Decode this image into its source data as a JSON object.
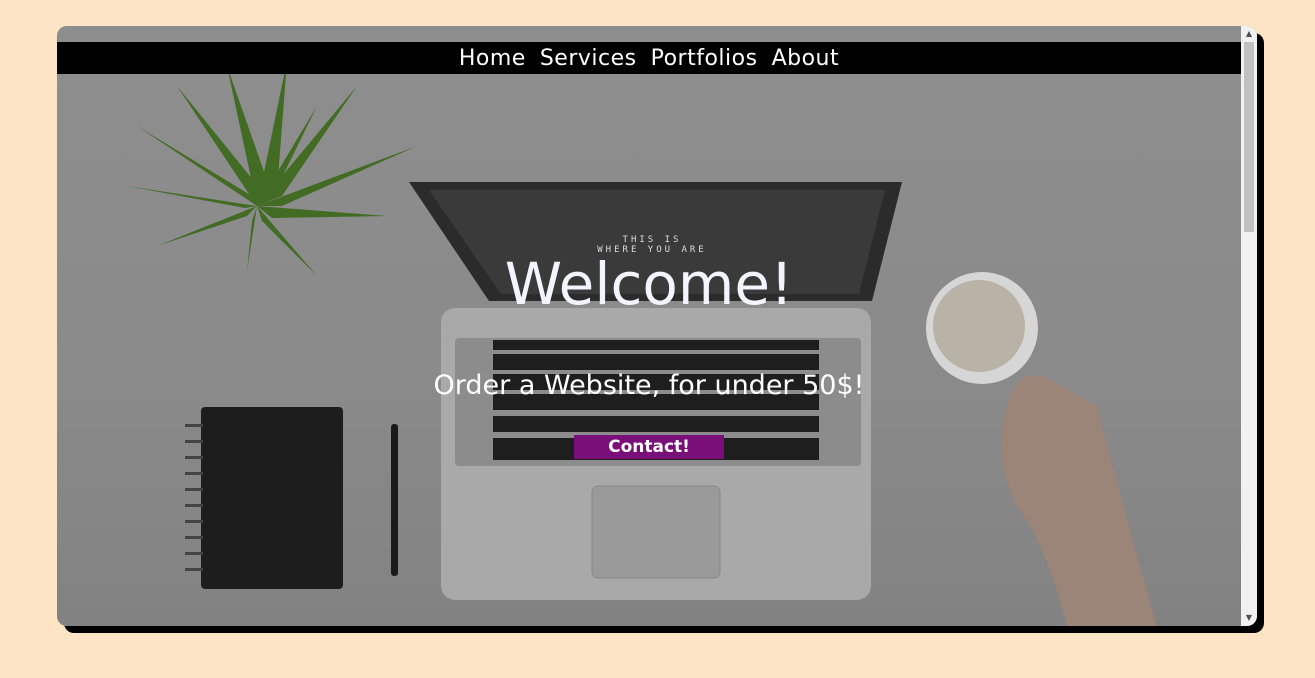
{
  "nav": {
    "items": [
      {
        "label": "Home"
      },
      {
        "label": "Services"
      },
      {
        "label": "Portfolios"
      },
      {
        "label": "About"
      }
    ]
  },
  "hero": {
    "title": "Welcome!",
    "subtitle": "Order a Website, for under 50$!",
    "cta_label": "Contact!",
    "screen_text_line1": "THIS IS",
    "screen_text_line2": "WHERE YOU ARE"
  },
  "colors": {
    "page_background": "#fde4c4",
    "navbar": "#000000",
    "cta": "#7a0f7a",
    "text": "#ffffff"
  }
}
